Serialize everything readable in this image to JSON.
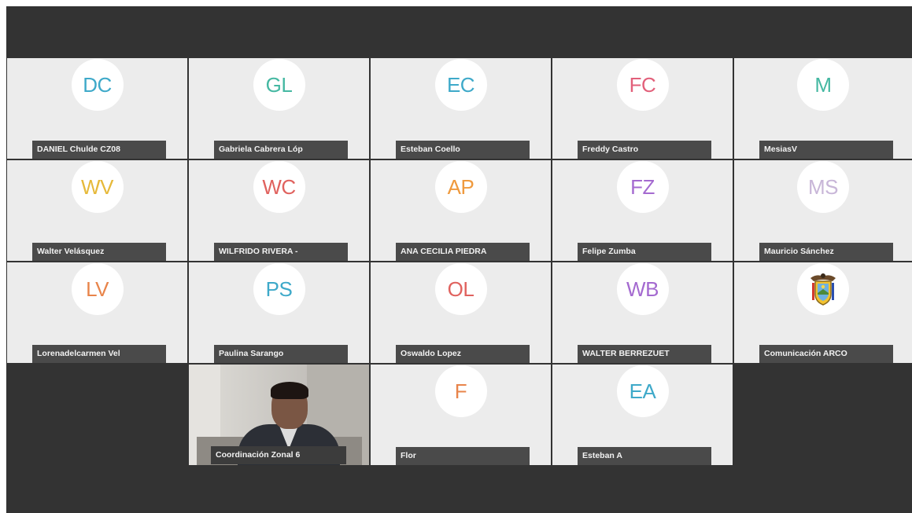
{
  "participants": [
    {
      "initials": "DC",
      "name": "DANIEL Chulde CZ08",
      "color": "#3ea9c9"
    },
    {
      "initials": "GL",
      "name": "Gabriela Cabrera Lóp",
      "color": "#45b8a2"
    },
    {
      "initials": "EC",
      "name": "Esteban Coello",
      "color": "#3ea9c9"
    },
    {
      "initials": "FC",
      "name": "Freddy Castro",
      "color": "#e2607a"
    },
    {
      "initials": "M",
      "name": "MesiasV",
      "color": "#45b8a2"
    },
    {
      "initials": "WV",
      "name": "Walter Velásquez",
      "color": "#e6b93a"
    },
    {
      "initials": "WC",
      "name": "WILFRIDO RIVERA -",
      "color": "#e0625e"
    },
    {
      "initials": "AP",
      "name": "ANA CECILIA PIEDRA",
      "color": "#ef9a3e"
    },
    {
      "initials": "FZ",
      "name": "Felipe Zumba",
      "color": "#a46ad0"
    },
    {
      "initials": "MS",
      "name": "Mauricio Sánchez",
      "color": "#c8b6d8"
    },
    {
      "initials": "LV",
      "name": "Lorenadelcarmen Vel",
      "color": "#e8844a"
    },
    {
      "initials": "PS",
      "name": "Paulina Sarango",
      "color": "#3ea9c9"
    },
    {
      "initials": "OL",
      "name": "Oswaldo Lopez",
      "color": "#e0625e"
    },
    {
      "initials": "WB",
      "name": "WALTER BERREZUET",
      "color": "#a46ad0"
    },
    {
      "initials": "",
      "name": "Comunicación ARCO",
      "color": "#333333",
      "logo": "ecuador-coat-of-arms"
    },
    {
      "initials": "",
      "name": "Coordinación Zonal 6",
      "color": "#333333",
      "video": true
    },
    {
      "initials": "F",
      "name": "Flor",
      "color": "#e8844a"
    },
    {
      "initials": "EA",
      "name": "Esteban A",
      "color": "#3ea9c9"
    }
  ]
}
